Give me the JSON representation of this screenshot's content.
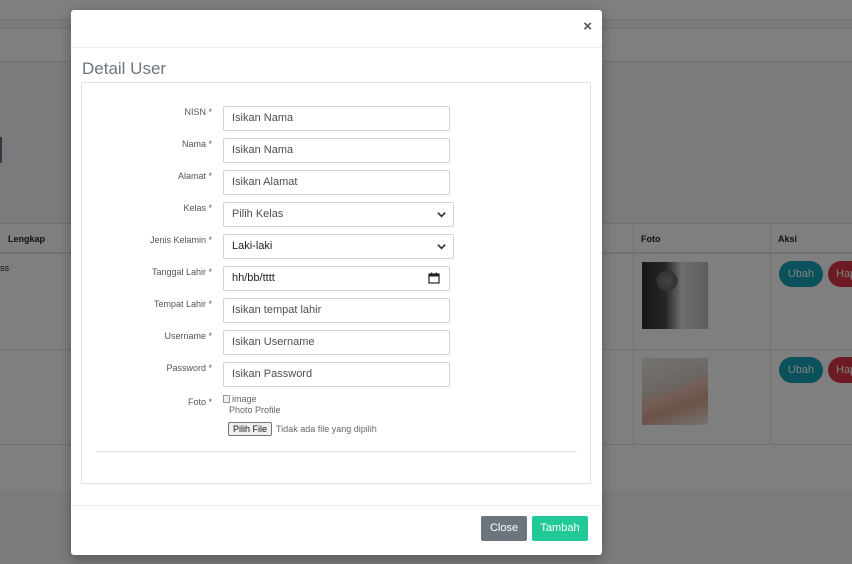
{
  "background": {
    "table": {
      "headers": {
        "lengkap": "Lengkap",
        "foto": "Foto",
        "aksi": "Aksi"
      },
      "row1_fragment": "ss",
      "ubah_label": "Ubah",
      "hapus_label": "Hap"
    }
  },
  "modal": {
    "close_symbol": "×",
    "title": "Detail User",
    "fields": {
      "nisn": {
        "label": "NISN *",
        "placeholder": "Isikan Nama"
      },
      "nama": {
        "label": "Nama *",
        "placeholder": "Isikan Nama"
      },
      "alamat": {
        "label": "Alamat *",
        "placeholder": "Isikan Alamat"
      },
      "kelas": {
        "label": "Kelas *",
        "value": "Pilih Kelas"
      },
      "jenis_kelamin": {
        "label": "Jenis Kelamin *",
        "value": "Laki-laki"
      },
      "tanggal_lahir": {
        "label": "Tanggal Lahir *",
        "value": "hh/bb/tttt"
      },
      "tempat_lahir": {
        "label": "Tempat Lahir *",
        "placeholder": "Isikan tempat lahir"
      },
      "username": {
        "label": "Username *",
        "placeholder": "Isikan Username"
      },
      "password": {
        "label": "Password *",
        "placeholder": "Isikan Password"
      },
      "foto": {
        "label": "Foto *",
        "image_alt": "image",
        "caption": "Photo Profile",
        "file_button": "Pilih File",
        "file_status": "Tidak ada file yang dipilih"
      }
    },
    "footer": {
      "close_label": "Close",
      "add_label": "Tambah"
    }
  }
}
